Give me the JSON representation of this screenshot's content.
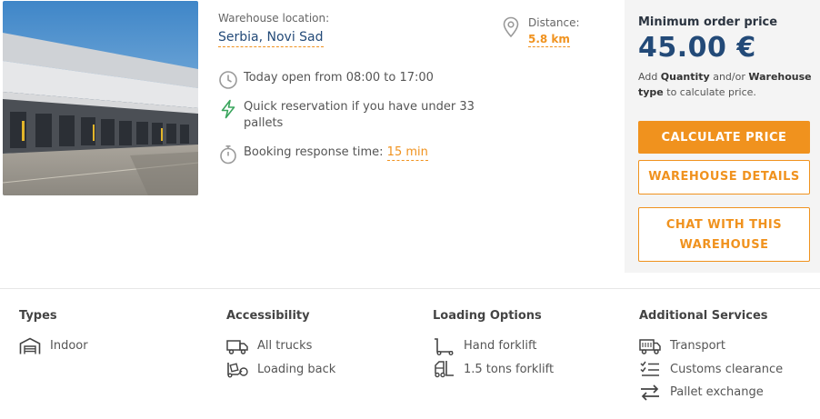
{
  "location": {
    "label": "Warehouse location:",
    "value": "Serbia, Novi Sad"
  },
  "distance": {
    "label": "Distance:",
    "value": "5.8 km"
  },
  "features": {
    "hours": "Today open from 08:00 to 17:00",
    "quick_line1": "Quick reservation if you have under 33",
    "quick_line2": "pallets",
    "response_label": "Booking response time:",
    "response_value": "15 min"
  },
  "pricing": {
    "label": "Minimum order price",
    "value": "45.00 €",
    "note_prefix": "Add",
    "note_quantity": "Quantity",
    "note_and": "and/or",
    "note_warehouse_type": "Warehouse type",
    "note_suffix": "to calculate price.",
    "calculate_button": "CALCULATE PRICE",
    "details_button": "WAREHOUSE DETAILS",
    "chat_button_line1": "CHAT WITH THIS",
    "chat_button_line2": "WAREHOUSE"
  },
  "categories": {
    "types": {
      "title": "Types",
      "items": [
        "Indoor"
      ]
    },
    "accessibility": {
      "title": "Accessibility",
      "items": [
        "All trucks",
        "Loading back"
      ]
    },
    "loading": {
      "title": "Loading Options",
      "items": [
        "Hand forklift",
        "1.5 tons forklift"
      ]
    },
    "services": {
      "title": "Additional Services",
      "items": [
        "Transport",
        "Customs clearance",
        "Pallet exchange"
      ]
    }
  },
  "icons": [
    "clock-icon",
    "lightning-icon",
    "stopwatch-icon",
    "map-pin-icon",
    "warehouse-icon",
    "truck-icon",
    "loading-back-icon",
    "hand-forklift-icon",
    "forklift-icon",
    "transport-truck-icon",
    "checklist-icon",
    "exchange-arrows-icon"
  ],
  "colors": {
    "accent": "#f0921e",
    "brand": "#234a78",
    "lightning": "#3aa55d",
    "panel": "#f4f4f4"
  }
}
